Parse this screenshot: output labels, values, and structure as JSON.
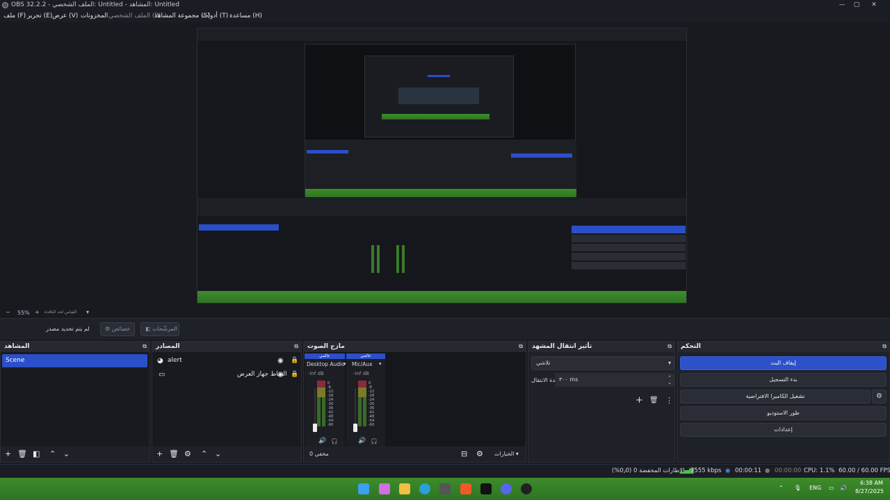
{
  "window": {
    "title": "OBS 32.2.2 - الملف الشخصي: Untitled - المشاهد: Untitled",
    "controls": [
      "—",
      "▢",
      "✕"
    ]
  },
  "menubar": {
    "items": [
      "ملف (F)",
      "تحرير (E)",
      "عرض (V)",
      "المخزونات",
      "الملف الشخصي (P)",
      "مجموعة المشاهد (S)",
      "أدوات (T)",
      "مساعدة (H)"
    ]
  },
  "zoom": {
    "level": "55%",
    "mode": "القياس لحد النافذة",
    "minus": "−",
    "plus": "+"
  },
  "contextbar": {
    "no_source": "لم يتم تحديد مصدر",
    "properties": "خصائص",
    "filters": "المرشّحات"
  },
  "docks": {
    "scenes": {
      "title": "المشاهد",
      "items": [
        "Scene"
      ]
    },
    "sources": {
      "title": "المصادر",
      "items": [
        {
          "name": "alert",
          "icon": "browser-icon"
        },
        {
          "name": "التقاط جهاز العرض",
          "icon": "display-icon"
        }
      ]
    },
    "mixer": {
      "title": "مازج الصوت",
      "channels": [
        {
          "head": "عالمي",
          "name": "Desktop Audio",
          "level": "-inf dB"
        },
        {
          "head": "عالمي",
          "name": "Mic/Aux",
          "level": "-inf dB"
        }
      ],
      "ticks": [
        "0",
        "-6",
        "-12",
        "-18",
        "-24",
        "-30",
        "-36",
        "-42",
        "-48",
        "-54",
        "-60"
      ],
      "footer_left": "مخفي 0",
      "footer_options": "الخيارات"
    },
    "transitions": {
      "title": "تأثير انتقال المشهد",
      "selected": "تلاشي",
      "duration_label": "مدة الانتقال",
      "duration_value": "٣٠٠ ms"
    },
    "controls": {
      "title": "التحكم",
      "buttons": [
        "إيقاف البث",
        "بدء التسجيل",
        "تشغيل الكاميرا الافتراضية",
        "طور الاستوديو",
        "إعدادات"
      ]
    }
  },
  "statusbar": {
    "dropped": "الإطارات المخفضة 0 (0٫0%)",
    "bitrate": "7555 kbps",
    "stream_time": "00:00:11",
    "rec_time": "00:00:00",
    "cpu": "CPU: 1.1%",
    "fps": "60.00 / 60.00 FPS"
  },
  "taskbar": {
    "lang": "ENG",
    "time": "6:38 AM",
    "date": "8/27/2025"
  },
  "colors": {
    "accent": "#2b4ec9",
    "panel": "#1f2128",
    "background": "#181a20",
    "grass": "#3d8c2d"
  }
}
